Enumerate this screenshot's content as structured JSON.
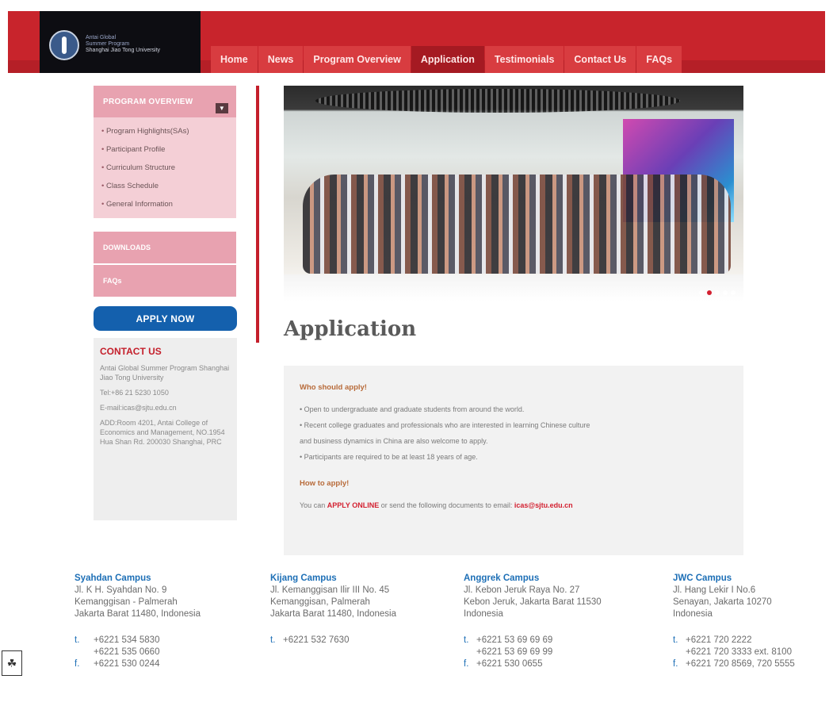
{
  "header": {
    "logo_lines": [
      "Antai Global",
      "Summer Program",
      "Shanghai Jiao Tong University"
    ],
    "nav": [
      "Home",
      "News",
      "Program Overview",
      "Application",
      "Testimonials",
      "Contact Us",
      "FAQs"
    ],
    "active_nav": "Application"
  },
  "sidebar": {
    "program_overview": "PROGRAM OVERVIEW",
    "items": [
      "Program Highlights(SAs)",
      "Participant Profile",
      "Curriculum Structure",
      "Class Schedule",
      "General Information"
    ],
    "downloads": "DOWNLOADS",
    "faqs": "FAQs",
    "apply_now": "APPLY NOW",
    "contact_title": "CONTACT US",
    "contact_lines": [
      "Antai Global Summer Program Shanghai Jiao Tong University",
      "Tel:+86 21 5230 1050",
      "E-mail:icas@sjtu.edu.cn",
      "ADD:Room 4201, Antai College of Economics and Management, NO.1954 Hua Shan Rd. 200030 Shanghai, PRC"
    ]
  },
  "main": {
    "title": "Application",
    "who_heading": "Who should apply!",
    "who_items": [
      "Open to undergraduate and graduate students from around the world.",
      "Recent college graduates and professionals who are interested in learning Chinese culture",
      "and business dynamics in China are also welcome to apply.",
      "Participants are required to be at least 18 years of age."
    ],
    "how_heading": "How to apply!",
    "how_prefix": "You can",
    "apply_online": "APPLY ONLINE",
    "how_middle": "or send the following documents to email:",
    "email": "icas@sjtu.edu.cn"
  },
  "footer": {
    "campuses": [
      {
        "name": "Syahdan Campus",
        "address": [
          "Jl. K H. Syahdan No. 9",
          "Kemanggisan - Palmerah",
          "Jakarta Barat 11480, Indonesia"
        ],
        "phones": [
          [
            "t.",
            "+6221 534 5830"
          ],
          [
            "",
            "+6221 535 0660"
          ],
          [
            "f.",
            "+6221 530 0244"
          ]
        ]
      },
      {
        "name": "Kijang Campus",
        "address": [
          "Jl. Kemanggisan Ilir III No. 45",
          "Kemanggisan, Palmerah",
          "Jakarta Barat 11480, Indonesia"
        ],
        "phones": [
          [
            "t.",
            "+6221 532 7630"
          ]
        ]
      },
      {
        "name": "Anggrek Campus",
        "address": [
          "Jl. Kebon Jeruk Raya No. 27",
          "Kebon Jeruk, Jakarta Barat 11530",
          "Indonesia"
        ],
        "phones": [
          [
            "t.",
            "+6221 53 69 69 69"
          ],
          [
            "",
            "+6221 53 69 69 99"
          ],
          [
            "f.",
            "+6221 530 0655"
          ]
        ]
      },
      {
        "name": "JWC Campus",
        "address": [
          "Jl. Hang Lekir I No.6",
          "Senayan, Jakarta 10270",
          "Indonesia"
        ],
        "phones": [
          [
            "t.",
            "+6221 720 2222"
          ],
          [
            "",
            "+6221 720 3333 ext. 8100"
          ],
          [
            "f.",
            "+6221 720 8569, 720 5555"
          ]
        ]
      }
    ]
  },
  "colors": {
    "brand_red": "#c8242c",
    "link_blue": "#1d6fb6",
    "apply_blue": "#1460ad"
  }
}
